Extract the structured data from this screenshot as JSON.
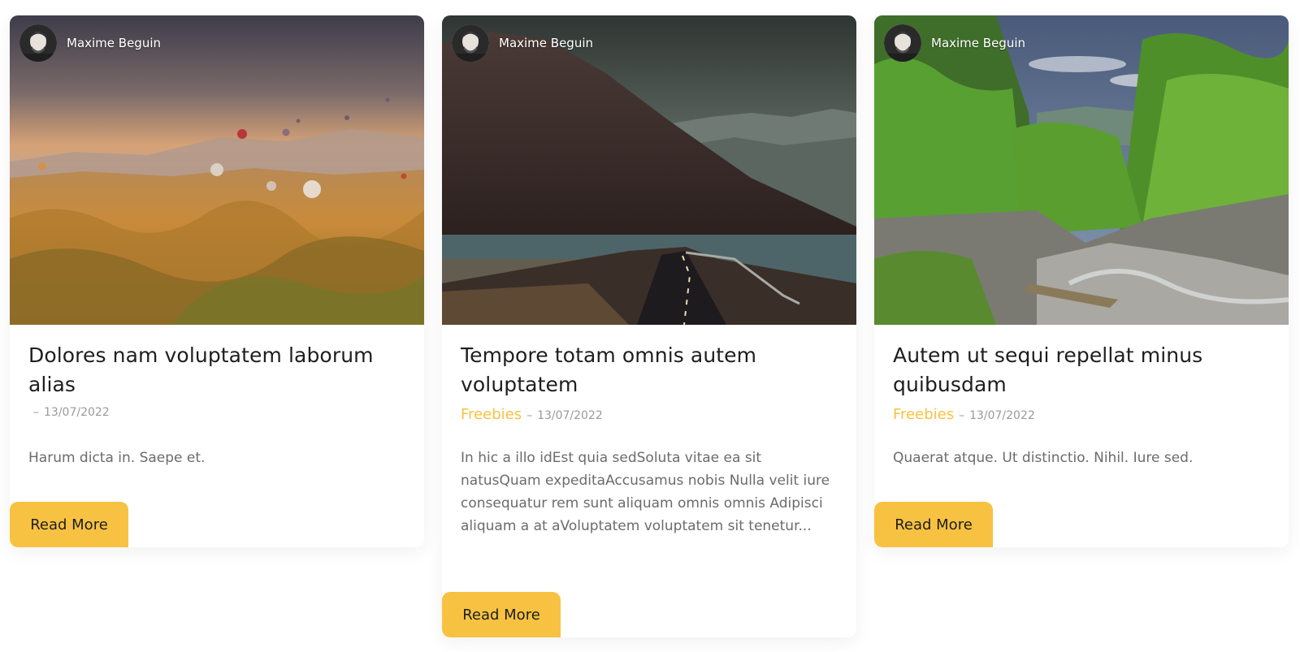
{
  "cards": [
    {
      "author": "Maxime Beguin",
      "title": "Dolores nam voluptatem laborum alias",
      "category": "",
      "date": "13/07/2022",
      "excerpt": "Harum dicta in. Saepe et.",
      "button": "Read More"
    },
    {
      "author": "Maxime Beguin",
      "title": "Tempore totam omnis autem voluptatem",
      "category": "Freebies",
      "date": "13/07/2022",
      "excerpt": "In hic a illo idEst quia sedSoluta vitae ea sit natusQuam expeditaAccusamus nobis Nulla velit iure consequatur rem sunt aliquam omnis omnis Adipisci aliquam a at aVoluptatem voluptatem sit tenetur...",
      "button": "Read More"
    },
    {
      "author": "Maxime Beguin",
      "title": "Autem ut sequi repellat minus quibusdam",
      "category": "Freebies",
      "date": "13/07/2022",
      "excerpt": "Quaerat atque. Ut distinctio. Nihil. Iure sed.",
      "button": "Read More"
    }
  ],
  "colors": {
    "accent": "#f7c241",
    "title": "#1e1e1e",
    "meta": "#9a9a9a",
    "excerpt": "#6b6b6b"
  },
  "icons": {
    "avatar": "person-avatar-icon"
  }
}
